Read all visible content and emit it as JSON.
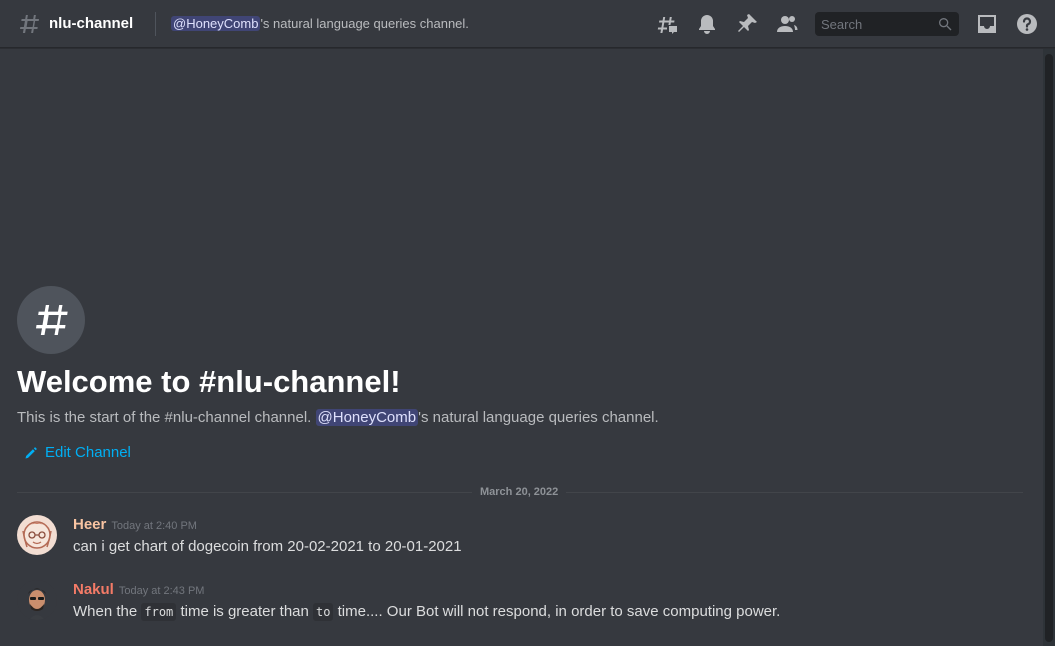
{
  "channel": {
    "name": "nlu-channel",
    "topic_mention": "@HoneyComb",
    "topic_rest": "'s natural language queries channel."
  },
  "toolbar": {
    "icons": [
      "threads-icon",
      "notification-bell-icon",
      "pin-icon",
      "member-list-icon",
      "inbox-icon",
      "help-icon"
    ],
    "search_placeholder": "Search"
  },
  "welcome": {
    "title": "Welcome to #nlu-channel!",
    "desc_prefix": "This is the start of the #nlu-channel channel. ",
    "desc_mention": "@HoneyComb",
    "desc_suffix": "'s natural language queries channel.",
    "edit_label": "Edit Channel"
  },
  "date_divider": "March 20, 2022",
  "messages": [
    {
      "author": "Heer",
      "author_color": "#f8c4a2",
      "timestamp": "Today at 2:40 PM",
      "text": "can i get chart of dogecoin from 20-02-2021 to 20-01-2021"
    },
    {
      "author": "Nakul",
      "author_color": "#f47b67",
      "timestamp": "Today at 2:43 PM",
      "parts": {
        "t1": "When the ",
        "c1": "from",
        "t2": " time is greater than ",
        "c2": "to",
        "t3": " time.... Our Bot will not respond, in order to save computing power."
      }
    }
  ],
  "colors": {
    "background": "#36393f",
    "link": "#00aff4",
    "mention_bg": "#4e5493"
  }
}
